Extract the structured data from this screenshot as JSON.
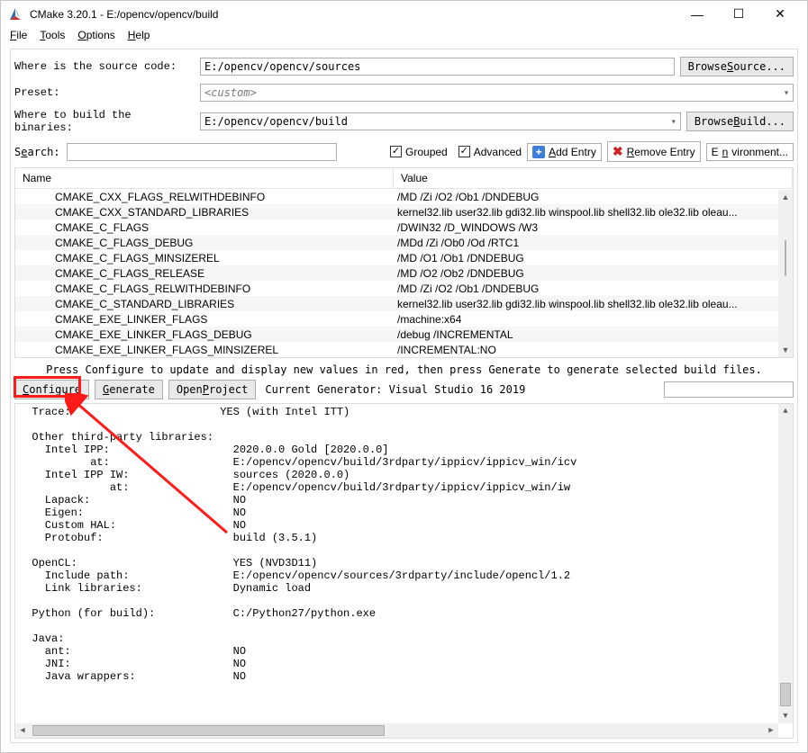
{
  "window": {
    "title": "CMake 3.20.1 - E:/opencv/opencv/build",
    "min_tip": "Minimize",
    "max_tip": "Maximize",
    "close_tip": "Close"
  },
  "menu": {
    "file": "File",
    "tools": "Tools",
    "options": "Options",
    "help": "Help"
  },
  "form": {
    "source_label": "Where is the source code:",
    "source_value": "E:/opencv/opencv/sources",
    "browse_source": "Browse Source...",
    "preset_label": "Preset:",
    "preset_value": "<custom>",
    "build_label": "Where to build the binaries:",
    "build_value": "E:/opencv/opencv/build",
    "browse_build": "Browse Build...",
    "search_label": "Search:",
    "search_value": "",
    "grouped": "Grouped",
    "advanced": "Advanced",
    "add_entry": "Add Entry",
    "remove_entry": "Remove Entry",
    "environment": "Environment..."
  },
  "list": {
    "name_header": "Name",
    "value_header": "Value",
    "rows": [
      {
        "n": "CMAKE_CXX_FLAGS_RELWITHDEBINFO",
        "v": "/MD /Zi /O2 /Ob1 /DNDEBUG"
      },
      {
        "n": "CMAKE_CXX_STANDARD_LIBRARIES",
        "v": "kernel32.lib user32.lib gdi32.lib winspool.lib shell32.lib ole32.lib oleau..."
      },
      {
        "n": "CMAKE_C_FLAGS",
        "v": "/DWIN32 /D_WINDOWS /W3"
      },
      {
        "n": "CMAKE_C_FLAGS_DEBUG",
        "v": "/MDd /Zi /Ob0 /Od /RTC1"
      },
      {
        "n": "CMAKE_C_FLAGS_MINSIZEREL",
        "v": "/MD /O1 /Ob1 /DNDEBUG"
      },
      {
        "n": "CMAKE_C_FLAGS_RELEASE",
        "v": "/MD /O2 /Ob2 /DNDEBUG"
      },
      {
        "n": "CMAKE_C_FLAGS_RELWITHDEBINFO",
        "v": "/MD /Zi /O2 /Ob1 /DNDEBUG"
      },
      {
        "n": "CMAKE_C_STANDARD_LIBRARIES",
        "v": "kernel32.lib user32.lib gdi32.lib winspool.lib shell32.lib ole32.lib oleau..."
      },
      {
        "n": "CMAKE_EXE_LINKER_FLAGS",
        "v": "/machine:x64"
      },
      {
        "n": "CMAKE_EXE_LINKER_FLAGS_DEBUG",
        "v": "/debug /INCREMENTAL"
      },
      {
        "n": "CMAKE_EXE_LINKER_FLAGS_MINSIZEREL",
        "v": "/INCREMENTAL:NO"
      }
    ]
  },
  "hint_text": "Press Configure to update and display new values in red, then press Generate to generate selected build files.",
  "actions": {
    "configure": "Configure",
    "generate": "Generate",
    "open_project": "Open Project",
    "status": "Current Generator: Visual Studio 16 2019"
  },
  "output_text": "  Trace:                       YES (with Intel ITT)\n\n  Other third-party libraries:\n    Intel IPP:                   2020.0.0 Gold [2020.0.0]\n           at:                   E:/opencv/opencv/build/3rdparty/ippicv/ippicv_win/icv\n    Intel IPP IW:                sources (2020.0.0)\n              at:                E:/opencv/opencv/build/3rdparty/ippicv/ippicv_win/iw\n    Lapack:                      NO\n    Eigen:                       NO\n    Custom HAL:                  NO\n    Protobuf:                    build (3.5.1)\n\n  OpenCL:                        YES (NVD3D11)\n    Include path:                E:/opencv/opencv/sources/3rdparty/include/opencl/1.2\n    Link libraries:              Dynamic load\n\n  Python (for build):            C:/Python27/python.exe\n\n  Java:\n    ant:                         NO\n    JNI:                         NO\n    Java wrappers:               NO"
}
